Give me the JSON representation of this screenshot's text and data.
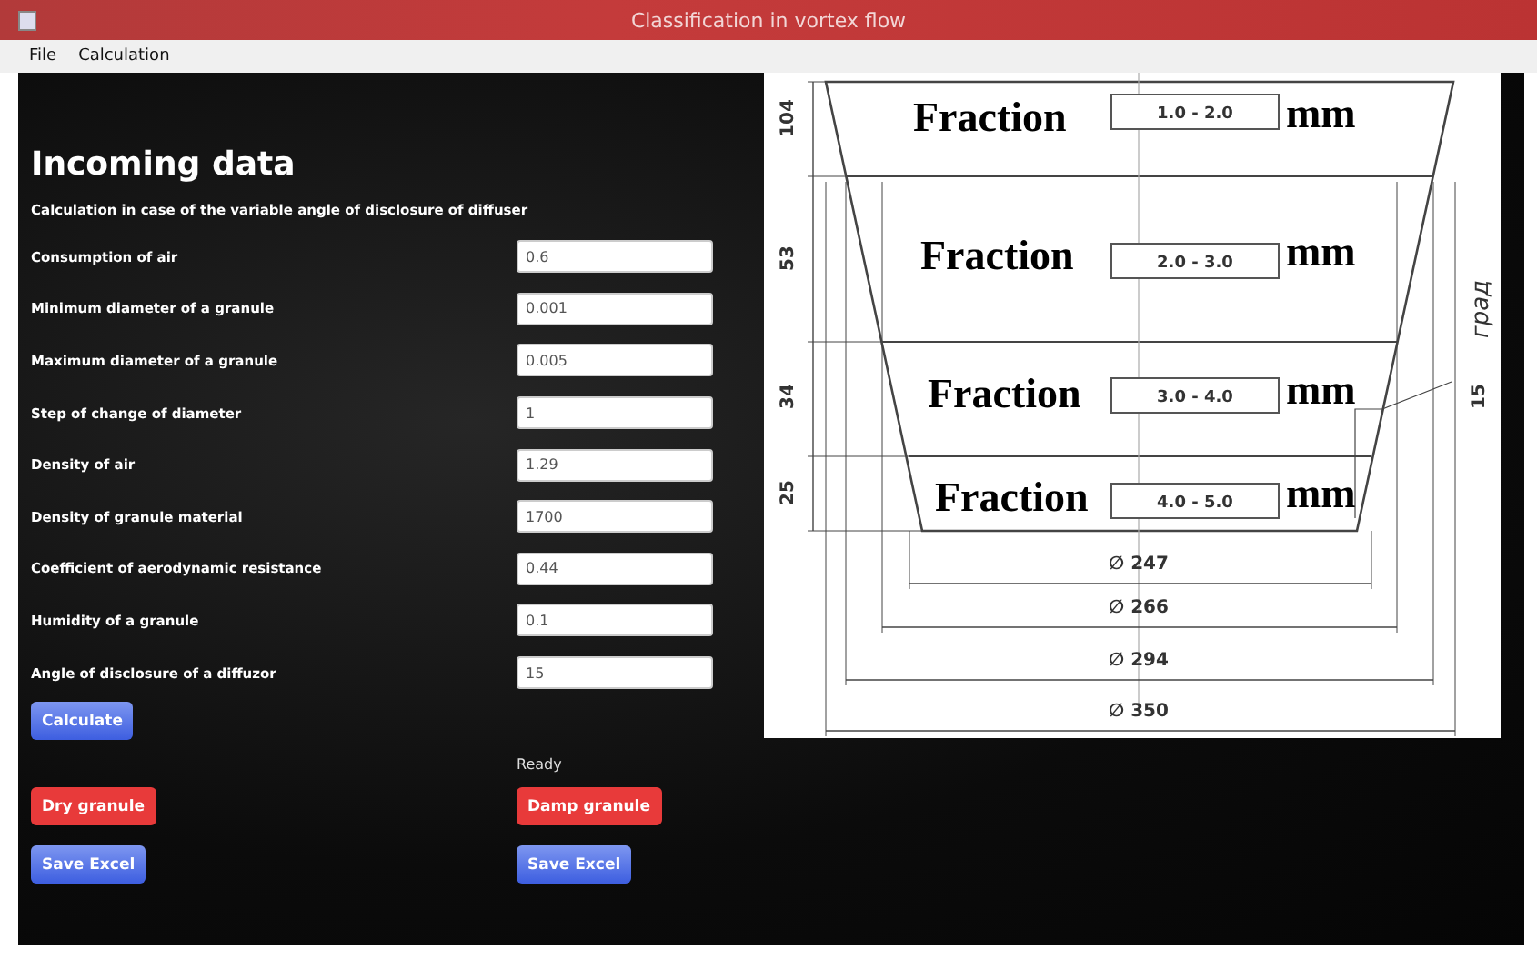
{
  "window": {
    "title": "Classification in vortex flow"
  },
  "menu": [
    "File",
    "Calculation"
  ],
  "form": {
    "heading": "Incoming data",
    "subtitle": "Calculation in case of the variable angle of disclosure of diffuser",
    "fields": [
      {
        "label": "Consumption of air",
        "value": "0.6"
      },
      {
        "label": "Minimum diameter of a granule",
        "value": "0.001"
      },
      {
        "label": "Maximum diameter of a granule",
        "value": "0.005"
      },
      {
        "label": "Step of change of diameter",
        "value": "1"
      },
      {
        "label": "Density of air",
        "value": "1.29"
      },
      {
        "label": "Density of granule material",
        "value": "1700"
      },
      {
        "label": "Coefficient of aerodynamic resistance",
        "value": "0.44"
      },
      {
        "label": "Humidity of a granule",
        "value": "0.1"
      },
      {
        "label": "Angle of disclosure of a diffuzor",
        "value": "15"
      }
    ]
  },
  "calculate": {
    "label": "Calculate",
    "kind": "primary"
  },
  "status": "Ready",
  "left_buttons": [
    {
      "label": "Dry granule",
      "kind": "danger"
    },
    {
      "label": "Save Excel",
      "kind": "primary"
    }
  ],
  "right_buttons": [
    {
      "label": "Damp granule",
      "kind": "danger"
    },
    {
      "label": "Save Excel",
      "kind": "primary"
    }
  ],
  "diagram": {
    "fractions": [
      {
        "label": "Fraction",
        "range": "1.0 - 2.0",
        "unit": "mm"
      },
      {
        "label": "Fraction",
        "range": "2.0 - 3.0",
        "unit": "mm"
      },
      {
        "label": "Fraction",
        "range": "3.0 - 4.0",
        "unit": "mm"
      },
      {
        "label": "Fraction",
        "range": "4.0 - 5.0",
        "unit": "mm"
      }
    ],
    "heights": [
      "104",
      "53",
      "34",
      "25"
    ],
    "angle": {
      "value": "15",
      "unit": "град"
    },
    "diameters": [
      "∅ 247",
      "∅ 266",
      "∅ 294",
      "∅ 350"
    ]
  }
}
